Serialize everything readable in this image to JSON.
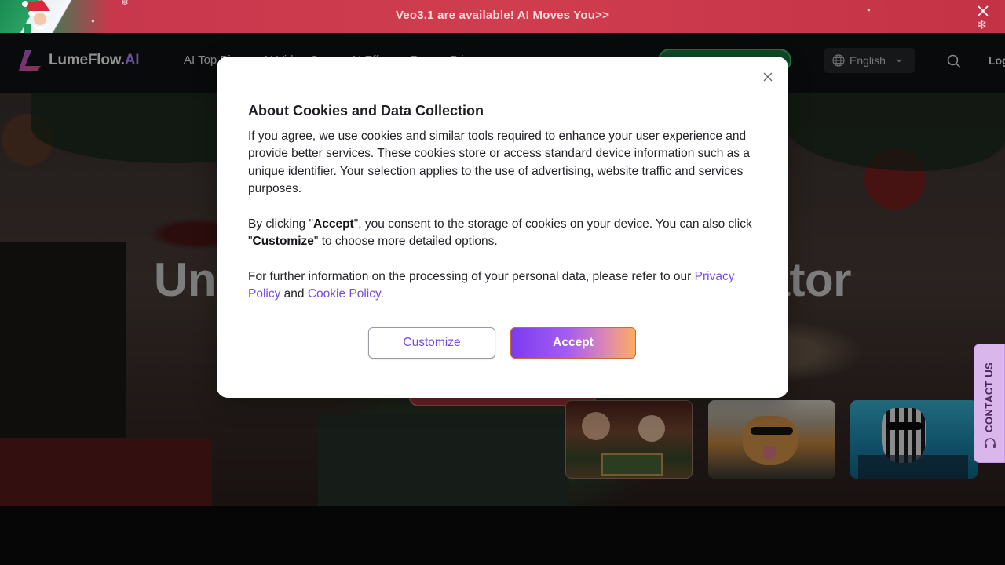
{
  "promo": {
    "text": "Veo3.1 are available! AI Moves You>>",
    "close_icon": "close-icon"
  },
  "nav": {
    "logo_main": "LumeFlow.",
    "logo_ai": "AI",
    "items": [
      "AI Top Pi",
      "AI Video G",
      "AI Eff",
      "R",
      "P i"
    ],
    "language": "English",
    "login": "Log"
  },
  "hero": {
    "title_left": "Unlea",
    "title_right": "erator"
  },
  "contact": {
    "label": "CONTACT US"
  },
  "modal": {
    "title": "About Cookies and Data Collection",
    "p1": "If you agree, we use cookies and similar tools required to enhance your user experience and provide better services. These cookies store or access standard device information such as a unique identifier. Your selection applies to the use of advertising, website traffic and services purposes.",
    "p2_pre": "By clicking \"",
    "p2_accept": "Accept",
    "p2_mid": "\", you consent to the storage of cookies on your device. You can also click \"",
    "p2_customize": "Customize",
    "p2_post": "\" to choose more detailed options.",
    "p3_pre": "For further information on the processing of your personal data, please refer to our ",
    "privacy_link": "Privacy Policy",
    "p3_and": " and ",
    "cookie_link": "Cookie Policy",
    "p3_end": ".",
    "customize_label": "Customize",
    "accept_label": "Accept"
  },
  "colors": {
    "accent": "#7a4ce0",
    "promo_bg": "#cf3d4f",
    "nav_bg": "#111214"
  }
}
